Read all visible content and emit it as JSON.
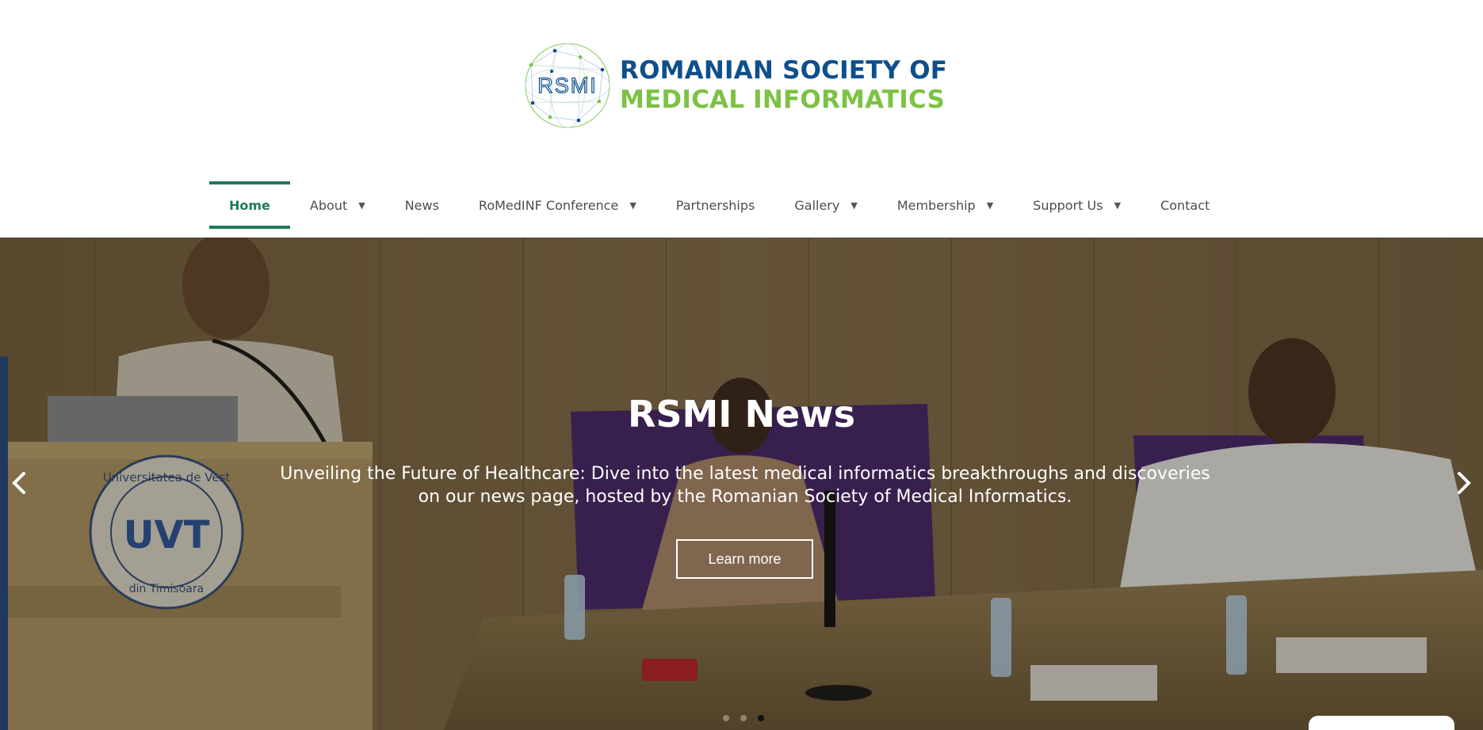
{
  "brand": {
    "logo_mark_text": "RSMI",
    "name_line1": "ROMANIAN SOCIETY OF",
    "name_line2": "MEDICAL INFORMATICS",
    "primary_color": "#0e4f8c",
    "secondary_color": "#7cc243"
  },
  "nav": {
    "items": [
      {
        "label": "Home",
        "active": true,
        "dropdown": false
      },
      {
        "label": "About",
        "active": false,
        "dropdown": true
      },
      {
        "label": "News",
        "active": false,
        "dropdown": false
      },
      {
        "label": "RoMedINF Conference",
        "active": false,
        "dropdown": true
      },
      {
        "label": "Partnerships",
        "active": false,
        "dropdown": false
      },
      {
        "label": "Gallery",
        "active": false,
        "dropdown": true
      },
      {
        "label": "Membership",
        "active": false,
        "dropdown": true
      },
      {
        "label": "Support Us",
        "active": false,
        "dropdown": true
      },
      {
        "label": "Contact",
        "active": false,
        "dropdown": false
      }
    ],
    "caret_glyph": "▼",
    "active_color": "#1e7a5a"
  },
  "hero": {
    "title": "RSMI News",
    "description": "Unveiling the Future of Healthcare: Dive into the latest medical informatics breakthroughs and discoveries on our news page, hosted by the Romanian Society of Medical Informatics.",
    "button_label": "Learn more",
    "prev_icon": "chevron-left-icon",
    "next_icon": "chevron-right-icon",
    "slides_count": 3,
    "active_slide": 3,
    "podium_seal_top": "Universitatea de Vest",
    "podium_seal_bottom": "din Timisoara",
    "podium_seal_mark": "UVT"
  }
}
